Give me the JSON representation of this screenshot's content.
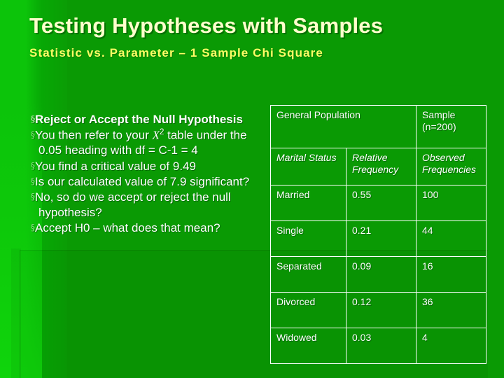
{
  "slide": {
    "title": "Testing Hypotheses with Samples",
    "subtitle": "Statistic vs. Parameter – 1 Sample Chi Square",
    "colors": {
      "background_green": "#0a9a04",
      "band_bright_green": "#0cc40a",
      "title_cream": "#ffffcc",
      "subtitle_yellow": "#ffff66",
      "body_white": "#ffffff",
      "bullet_green": "#8ee085",
      "sample_yellow_green": "#ddf06a",
      "table_border_white": "#ffffff"
    }
  },
  "body": {
    "bullet_glyph": "§",
    "bullets": [
      {
        "text": "Reject or Accept the Null Hypothesis",
        "bold": true
      },
      {
        "text_before": "You then refer to your  ",
        "chi": "X",
        "chi_sup": "2",
        "text_after": " table under the 0.05 heading with df = C-1 = 4",
        "bold": false
      },
      {
        "text": "You find a critical value of 9.49",
        "bold": false
      },
      {
        "text": "Is our calculated value of 7.9 significant?",
        "bold": false
      },
      {
        "text": "No, so do we accept or reject the null hypothesis?",
        "bold": false
      },
      {
        "text": "Accept H0 – what does that mean?",
        "bold": false
      }
    ]
  },
  "table": {
    "group_headers": [
      {
        "label": "General Population",
        "colspan": 2,
        "accent": false
      },
      {
        "label": "Sample (n=200)",
        "colspan": 1,
        "accent": true
      }
    ],
    "column_headers": [
      {
        "label": "Marital Status",
        "accent": false
      },
      {
        "label": "Relative Frequency",
        "accent": false
      },
      {
        "label": "Observed Frequencies",
        "accent": true
      }
    ],
    "rows": [
      {
        "status": "Married",
        "relative_frequency": "0.55",
        "observed_frequency": "100"
      },
      {
        "status": "Single",
        "relative_frequency": "0.21",
        "observed_frequency": "44"
      },
      {
        "status": "Separated",
        "relative_frequency": "0.09",
        "observed_frequency": "16"
      },
      {
        "status": "Divorced",
        "relative_frequency": "0.12",
        "observed_frequency": "36"
      },
      {
        "status": "Widowed",
        "relative_frequency": "0.03",
        "observed_frequency": "4"
      }
    ]
  }
}
